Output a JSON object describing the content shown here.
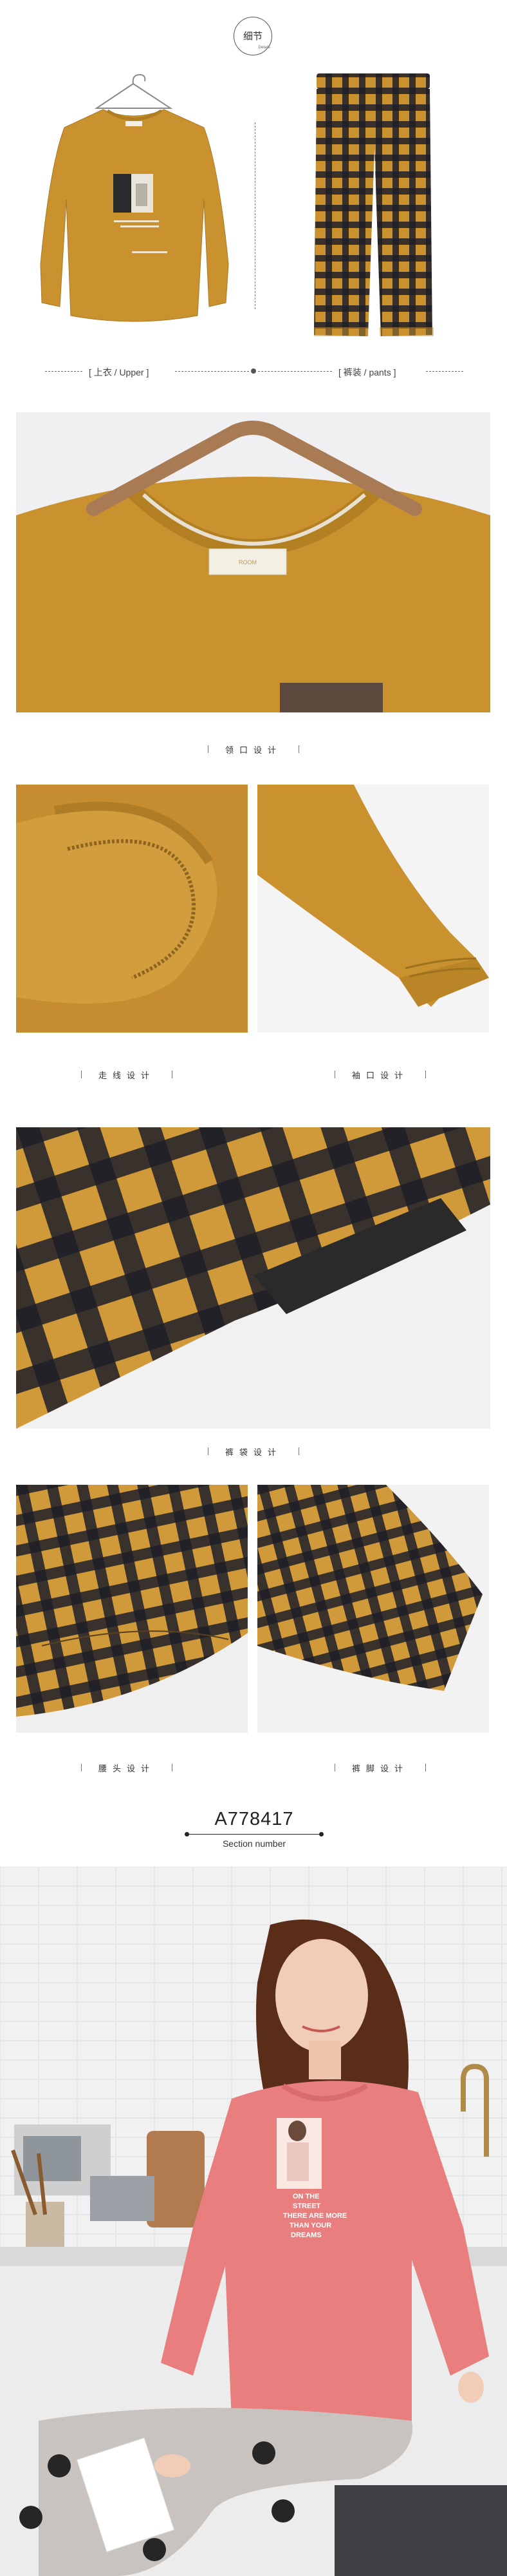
{
  "badge": {
    "title": "细节",
    "subtitle": "Details"
  },
  "flat_captions": {
    "upper": "[ 上衣 / Upper ]",
    "pants": "[ 裤装 / pants ]"
  },
  "shirt_print_text": "ONE TODAY IS WORTH TWO TOMORROWS",
  "collar_label_text": "ROOM",
  "captions": {
    "collar": "领口设计",
    "stitch": "走线设计",
    "cuff": "袖口设计",
    "pocket": "裤袋设计",
    "waist": "腰头设计",
    "hem": "裤脚设计"
  },
  "section": {
    "code": "A778417",
    "label": "Section number"
  },
  "model_print_text": [
    "ON THE",
    "STREET",
    "THERE ARE MORE",
    "THAN YOUR",
    "DREAMS"
  ],
  "colors": {
    "mustard": "#c9922f",
    "check_dark": "#1e1e28",
    "pink": "#e97e7e"
  }
}
